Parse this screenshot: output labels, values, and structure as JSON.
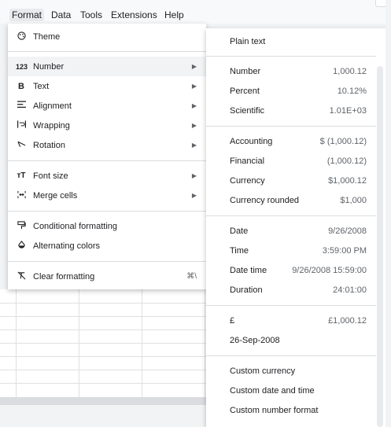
{
  "menubar": {
    "items": [
      "Format",
      "Data",
      "Tools",
      "Extensions",
      "Help"
    ]
  },
  "format_menu": {
    "theme": "Theme",
    "number": "Number",
    "text": "Text",
    "alignment": "Alignment",
    "wrapping": "Wrapping",
    "rotation": "Rotation",
    "font_size": "Font size",
    "merge_cells": "Merge cells",
    "conditional_formatting": "Conditional formatting",
    "alternating_colors": "Alternating colors",
    "clear_formatting": "Clear formatting",
    "clear_formatting_shortcut": "⌘\\",
    "number_icon": "123"
  },
  "number_submenu": {
    "plain_text": "Plain text",
    "number": {
      "label": "Number",
      "example": "1,000.12"
    },
    "percent": {
      "label": "Percent",
      "example": "10.12%"
    },
    "scientific": {
      "label": "Scientific",
      "example": "1.01E+03"
    },
    "accounting": {
      "label": "Accounting",
      "example": "$ (1,000.12)"
    },
    "financial": {
      "label": "Financial",
      "example": "(1,000.12)"
    },
    "currency": {
      "label": "Currency",
      "example": "$1,000.12"
    },
    "currency_rounded": {
      "label": "Currency rounded",
      "example": "$1,000"
    },
    "date": {
      "label": "Date",
      "example": "9/26/2008"
    },
    "time": {
      "label": "Time",
      "example": "3:59:00 PM"
    },
    "date_time": {
      "label": "Date time",
      "example": "9/26/2008 15:59:00"
    },
    "duration": {
      "label": "Duration",
      "example": "24:01:00"
    },
    "pound": {
      "label": "£",
      "example": "£1,000.12"
    },
    "date_custom": {
      "label": "26-Sep-2008",
      "example": ""
    },
    "custom_currency": "Custom currency",
    "custom_date_time": "Custom date and time",
    "custom_number_format": "Custom number format"
  }
}
